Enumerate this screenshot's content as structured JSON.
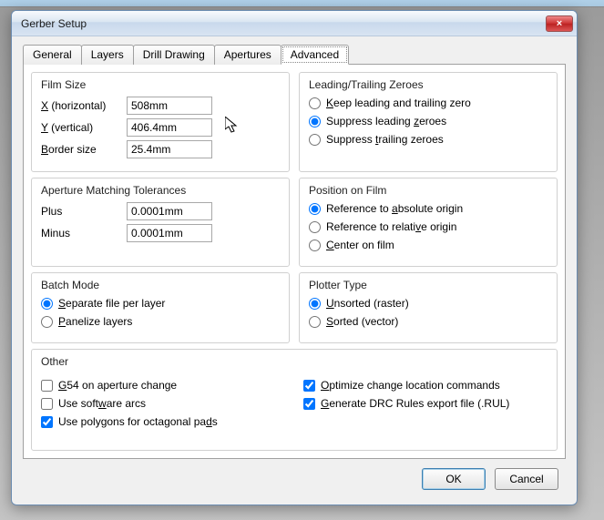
{
  "window": {
    "title": "Gerber Setup",
    "close_label": "×"
  },
  "tabs": {
    "items": [
      "General",
      "Layers",
      "Drill Drawing",
      "Apertures",
      "Advanced"
    ],
    "active_index": 4
  },
  "film_size": {
    "title": "Film Size",
    "x_label_u": "X",
    "x_label_rest": " (horizontal)",
    "x_value": "508mm",
    "y_label_u": "Y",
    "y_label_rest": " (vertical)",
    "y_value": "406.4mm",
    "border_label_u": "B",
    "border_label_rest": "order size",
    "border_value": "25.4mm"
  },
  "zeroes": {
    "title": "Leading/Trailing Zeroes",
    "keep": {
      "u": "K",
      "rest": "eep leading and trailing zero"
    },
    "s_lead": {
      "pre": "Suppress leading ",
      "u": "z",
      "post": "eroes"
    },
    "s_trail": {
      "pre": "Suppress ",
      "u": "t",
      "post": "railing zeroes"
    },
    "selected": "s_lead"
  },
  "aperture_tol": {
    "title": "Aperture Matching Tolerances",
    "plus_label": "Plus",
    "plus_value": "0.0001mm",
    "minus_label": "Minus",
    "minus_value": "0.0001mm"
  },
  "position": {
    "title": "Position on Film",
    "abs": {
      "pre": "Reference to ",
      "u": "a",
      "post": "bsolute origin"
    },
    "rel": {
      "pre": "Reference to relati",
      "u": "v",
      "post": "e origin"
    },
    "center": {
      "u": "C",
      "post": "enter on film"
    },
    "selected": "abs"
  },
  "batch": {
    "title": "Batch Mode",
    "sep": {
      "u": "S",
      "post": "eparate file per layer"
    },
    "pan": {
      "u": "P",
      "post": "anelize layers"
    },
    "selected": "sep"
  },
  "plotter": {
    "title": "Plotter Type",
    "uns": {
      "u": "U",
      "post": "nsorted (raster)"
    },
    "srt": {
      "u": "S",
      "post": "orted (vector)"
    },
    "selected": "uns"
  },
  "other": {
    "title": "Other",
    "g54": {
      "u": "G",
      "post": "54 on aperture change",
      "checked": false
    },
    "sw_arcs": {
      "pre": "Use soft",
      "u": "w",
      "post": "are arcs",
      "checked": false
    },
    "polys": {
      "pre": "Use polygons for octagonal pa",
      "u": "d",
      "post": "s",
      "checked": true
    },
    "opt": {
      "u": "O",
      "post": "ptimize change location commands",
      "checked": true
    },
    "drc": {
      "u": "G",
      "post": "enerate DRC Rules export file (.RUL)",
      "checked": true
    }
  },
  "buttons": {
    "ok": "OK",
    "cancel": "Cancel"
  }
}
